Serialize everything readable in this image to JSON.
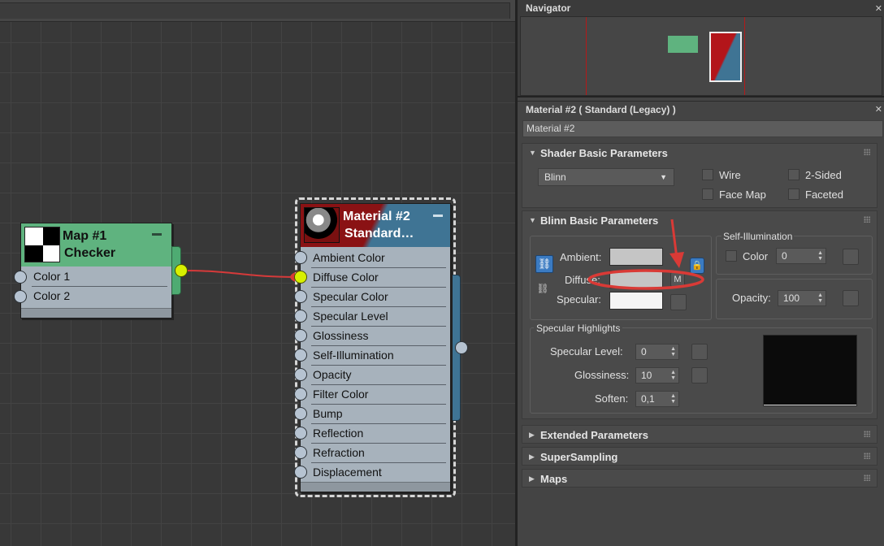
{
  "navigator": {
    "title": "Navigator"
  },
  "nodes": {
    "map": {
      "title_line1": "Map #1",
      "title_line2": "Checker",
      "slots": [
        "Color 1",
        "Color 2"
      ]
    },
    "material": {
      "title_line1": "Material #2",
      "title_line2": "Standard…",
      "slots": [
        "Ambient Color",
        "Diffuse Color",
        "Specular Color",
        "Specular Level",
        "Glossiness",
        "Self-Illumination",
        "Opacity",
        "Filter Color",
        "Bump",
        "Reflection",
        "Refraction",
        "Displacement"
      ]
    }
  },
  "editor": {
    "title": "Material #2  ( Standard (Legacy) )",
    "name_value": "Material #2",
    "shader": {
      "title": "Shader Basic Parameters",
      "shader_value": "Blinn",
      "wire": "Wire",
      "two_sided": "2-Sided",
      "face_map": "Face Map",
      "faceted": "Faceted"
    },
    "blinn": {
      "title": "Blinn Basic Parameters",
      "ambient": "Ambient:",
      "diffuse": "Diffuse:",
      "specular": "Specular:",
      "map_button": "M",
      "self_illum_title": "Self-Illumination",
      "color": "Color",
      "color_value": "0",
      "opacity": "Opacity:",
      "opacity_value": "100",
      "spec_title": "Specular Highlights",
      "spec_level": "Specular Level:",
      "spec_level_value": "0",
      "glossiness": "Glossiness:",
      "glossiness_value": "10",
      "soften": "Soften:",
      "soften_value": "0,1"
    },
    "rollouts": [
      "Extended Parameters",
      "SuperSampling",
      "Maps"
    ]
  },
  "colors": {
    "map_header": "#5fb37f",
    "material_header_left": "#8a1214",
    "material_header_right": "#3f7494",
    "node_body": "#a7b2bc",
    "wire": "#d63a3a",
    "active_port": "#d8f000",
    "annotation": "#d93a36"
  }
}
